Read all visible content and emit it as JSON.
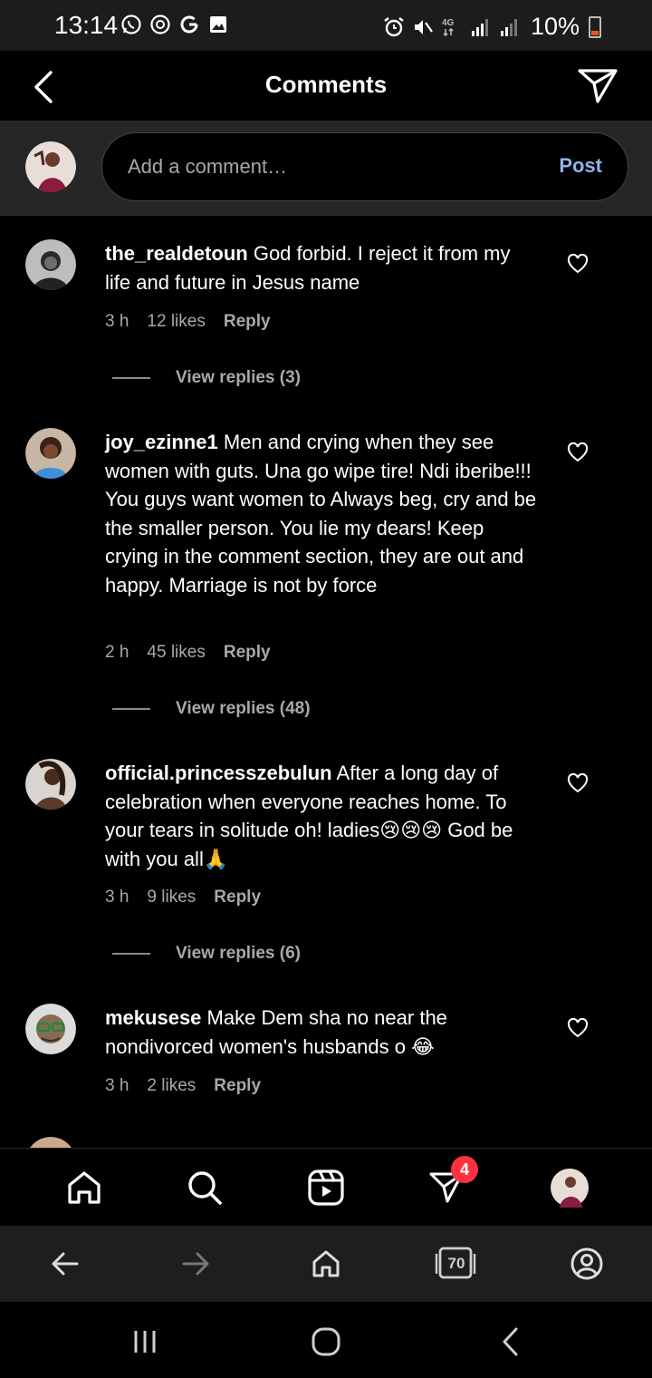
{
  "status_bar": {
    "time": "13:14",
    "network": "4G",
    "battery": "10%"
  },
  "header": {
    "title": "Comments"
  },
  "compose": {
    "placeholder": "Add a comment…",
    "post_label": "Post"
  },
  "comments": [
    {
      "username": "the_realdetoun",
      "text": "God forbid. I reject it from my life and future in Jesus name",
      "time": "3 h",
      "likes": "12 likes",
      "reply_label": "Reply",
      "view_replies": "View replies (3)"
    },
    {
      "username": "joy_ezinne1",
      "text": "Men and crying when they see women with guts. Una go wipe tire! Ndi iberibe!!! You guys want women to Always beg, cry and be the smaller person. You lie my dears! Keep crying in the comment section, they are out and happy. Marriage is not by force",
      "time": "2 h",
      "likes": "45 likes",
      "reply_label": "Reply",
      "view_replies": "View replies (48)"
    },
    {
      "username": "official.princesszebulun",
      "text": "After a long day of celebration when everyone reaches home. To your tears in solitude oh! ladies😢😢😢 God be with you all🙏",
      "time": "3 h",
      "likes": "9 likes",
      "reply_label": "Reply",
      "view_replies": "View replies (6)"
    },
    {
      "username": "mekusese",
      "text": "Make Dem sha no near the nondivorced women's husbands o 😂",
      "time": "3 h",
      "likes": "2 likes",
      "reply_label": "Reply"
    }
  ],
  "bottom_nav": {
    "activity_badge": "4"
  },
  "browser_bar": {
    "tab_count": "70"
  },
  "colors": {
    "accent_link": "#8fb3e8",
    "badge": "#ff3040",
    "muted_text": "#a8a8a8"
  }
}
